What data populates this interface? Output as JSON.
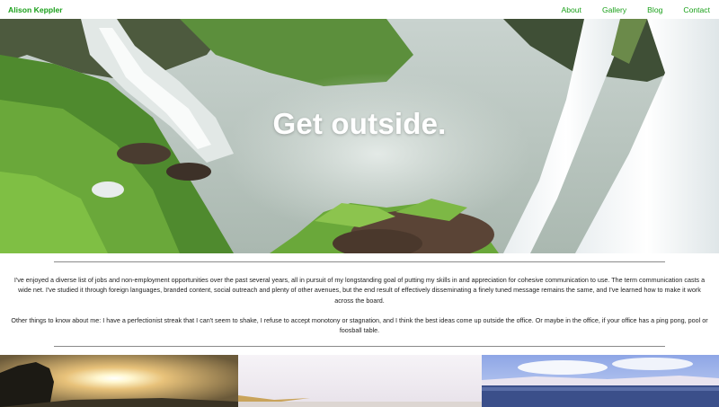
{
  "nav": {
    "brand": "Alison Keppler",
    "links": [
      {
        "label": "About"
      },
      {
        "label": "Gallery"
      },
      {
        "label": "Blog"
      },
      {
        "label": "Contact"
      }
    ]
  },
  "hero": {
    "title": "Get outside."
  },
  "bio": {
    "paragraphs": [
      "I've enjoyed a diverse list of jobs and non-employment opportunities over the past several years, all in pursuit of my longstanding goal of putting my skills in and appreciation for cohesive communication to use. The term communication casts a wide net. I've studied it through foreign languages, branded content, social outreach and plenty of other avenues, but the end result of effectively disseminating a finely tuned message remains the same, and I've learned how to make it work across the board.",
      "Other things to know about me: I have a perfectionist streak that I can't seem to shake, I refuse to accept monotony or stagnation, and I think the best ideas come up outside the office. Or maybe in the office, if your office has a ping pong, pool or foosball table."
    ]
  },
  "colors": {
    "accent": "#1aa01a",
    "text": "#222222",
    "divider": "#8a8a8a"
  }
}
